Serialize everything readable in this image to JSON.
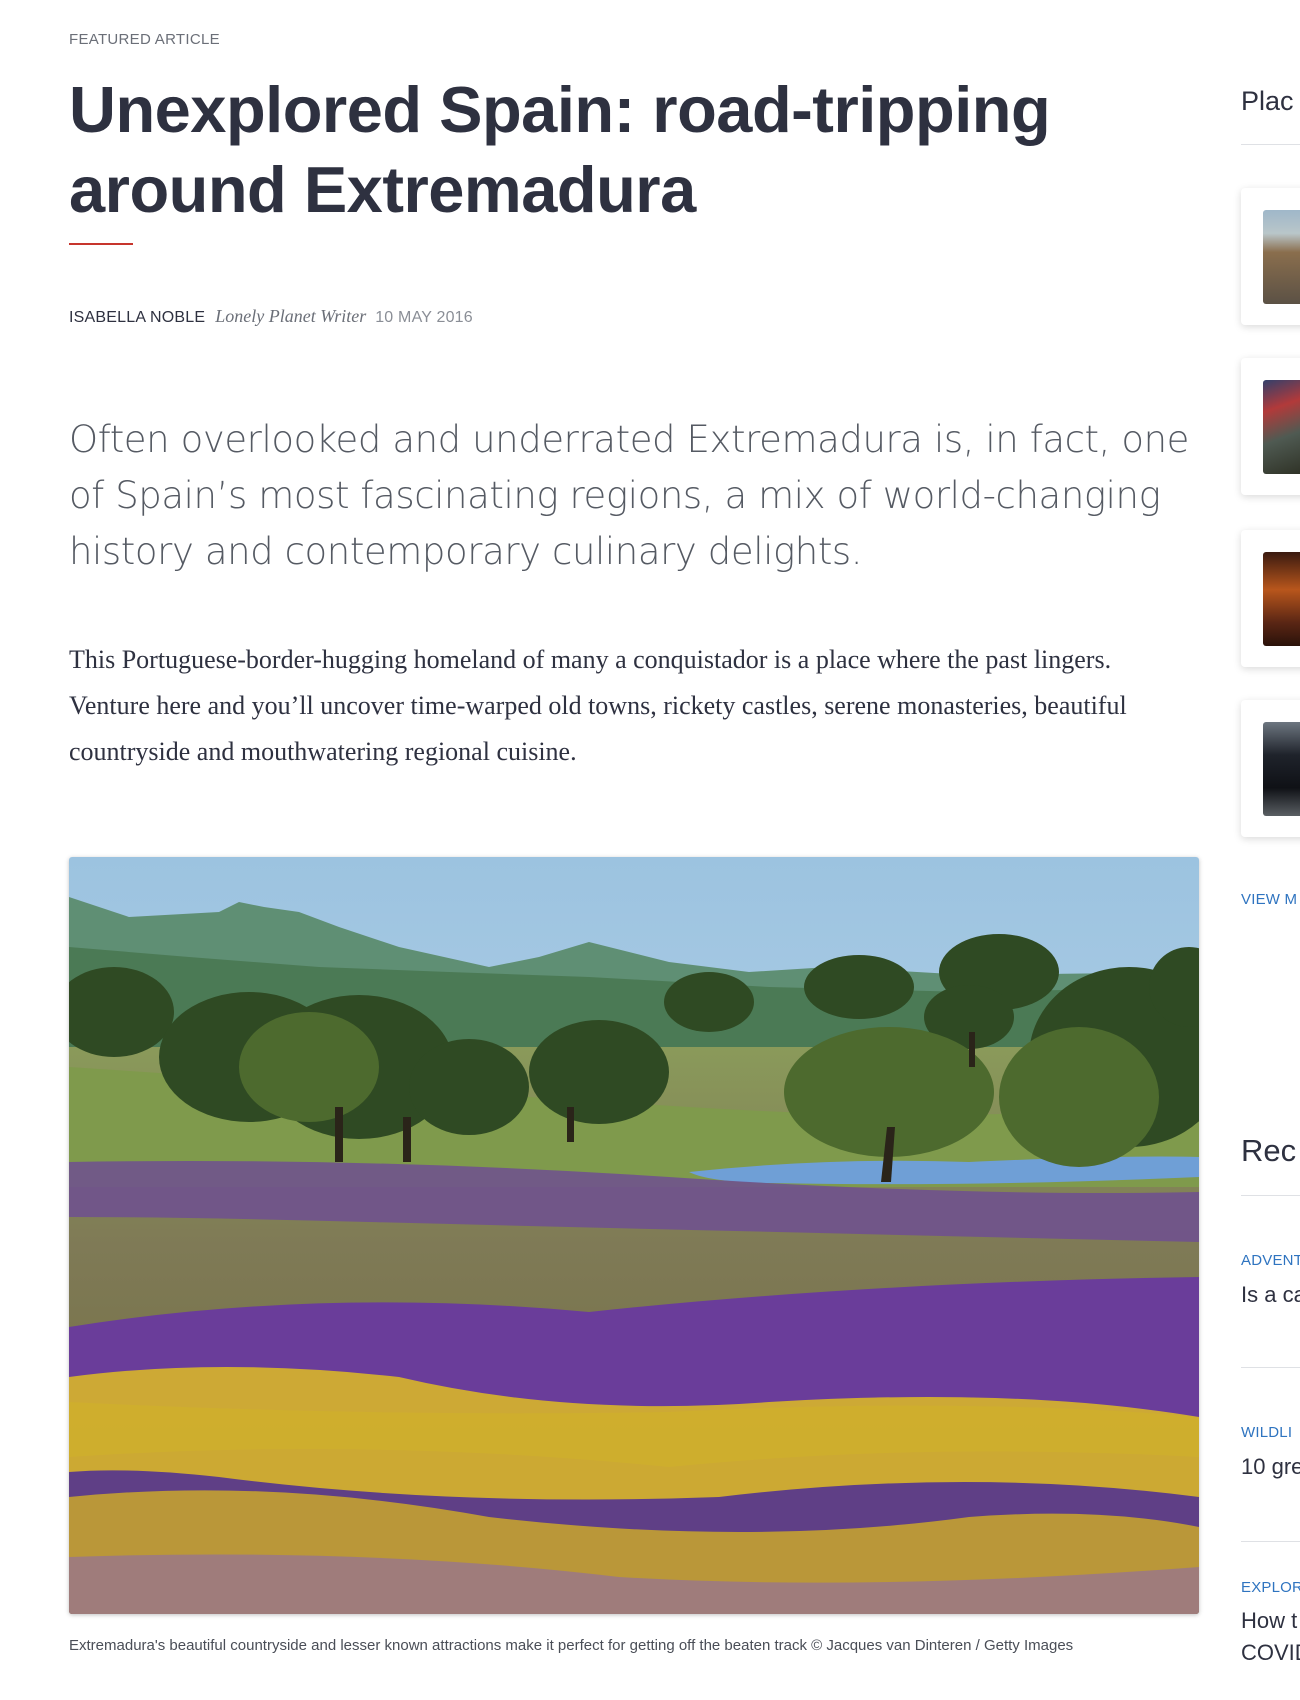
{
  "article": {
    "kicker": "FEATURED ARTICLE",
    "title": "Unexplored Spain: road-tripping around Extremadura",
    "author": "ISABELLA NOBLE",
    "author_role": "Lonely Planet Writer",
    "date": "10 MAY 2016",
    "lede": "Often overlooked and underrated Extremadura is, in fact, one of Spain’s most fascinating regions, a mix of world-changing history and contemporary culinary delights.",
    "body": "This Portuguese-border-hugging homeland of many a conquistador is a place where the past lingers. Venture here and you’ll uncover time-warped old towns, rickety castles, serene monasteries, beautiful countryside and mouthwatering regional cuisine.",
    "caption": "Extremadura's beautiful countryside and lesser known attractions make it perfect for getting off the beaten track © Jacques van Dinteren / Getty Images"
  },
  "sidebar": {
    "places_heading": "Plac",
    "view_more": "VIEW M",
    "recommended_heading": "Rec",
    "items": [
      {
        "category": "ADVENT",
        "title": "Is a ca"
      },
      {
        "category": "WILDLI",
        "title": "10 gre"
      },
      {
        "category": "EXPLOR",
        "title_line1": "How t",
        "title_line2": "COVID"
      }
    ]
  },
  "colors": {
    "accent_rule": "#c7352d",
    "link_blue": "#2f74c0",
    "heading_text": "#2e3140"
  }
}
